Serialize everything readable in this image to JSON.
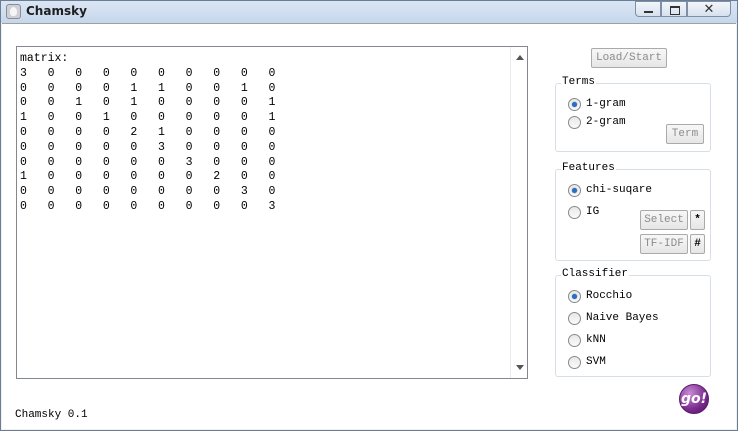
{
  "window": {
    "title": "Chamsky"
  },
  "matrix": {
    "text": "matrix:\n3   0   0   0   0   0   0   0   0   0\n0   0   0   0   1   1   0   0   1   0\n0   0   1   0   1   0   0   0   0   1\n1   0   0   1   0   0   0   0   0   1\n0   0   0   0   2   1   0   0   0   0\n0   0   0   0   0   3   0   0   0   0\n0   0   0   0   0   0   3   0   0   0\n1   0   0   0   0   0   0   2   0   0\n0   0   0   0   0   0   0   0   3   0\n0   0   0   0   0   0   0   0   0   3"
  },
  "controls": {
    "load_start": "Load/Start"
  },
  "terms": {
    "label": "Terms",
    "options": [
      {
        "label": "1-gram",
        "checked": true
      },
      {
        "label": "2-gram",
        "checked": false
      }
    ],
    "term_button": "Term"
  },
  "features": {
    "label": "Features",
    "options": [
      {
        "label": "chi-suqare",
        "checked": true
      },
      {
        "label": "IG",
        "checked": false
      }
    ],
    "select_button": "Select",
    "star_button": "*",
    "tfidf_button": "TF-IDF",
    "hash_button": "#"
  },
  "classifier": {
    "label": "Classifier",
    "options": [
      {
        "label": "Rocchio",
        "checked": true
      },
      {
        "label": "Naive Bayes",
        "checked": false
      },
      {
        "label": "kNN",
        "checked": false
      },
      {
        "label": "SVM",
        "checked": false
      }
    ]
  },
  "status": {
    "text": "Chamsky 0.1"
  },
  "go_button": {
    "label": "go!"
  },
  "titlebar_buttons": {
    "close_glyph": "✕"
  },
  "icons": {
    "app": "app-icon",
    "minimize": "minimize-icon",
    "maximize": "maximize-icon",
    "close": "close-icon",
    "scroll_up": "arrow-up-icon",
    "scroll_down": "arrow-down-icon"
  }
}
